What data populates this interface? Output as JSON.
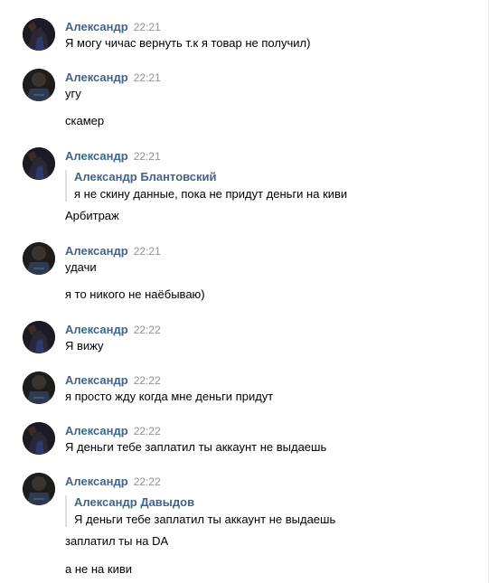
{
  "messages": [
    {
      "author": "Александр",
      "time": "22:21",
      "lines": [
        "Я могу чичас вернуть т.к я товар не получил)"
      ]
    },
    {
      "author": "Александр",
      "time": "22:21",
      "lines": [
        "угу",
        "скамер"
      ]
    },
    {
      "author": "Александр",
      "time": "22:21",
      "quote": {
        "author": "Александр Блантовский",
        "text": "я не скину данные, пока не придут деньги на киви"
      },
      "lines": [
        "Арбитраж"
      ]
    },
    {
      "author": "Александр",
      "time": "22:21",
      "lines": [
        "удачи",
        "я то никого не наёбываю)"
      ]
    },
    {
      "author": "Александр",
      "time": "22:22",
      "lines": [
        "Я вижу"
      ]
    },
    {
      "author": "Александр",
      "time": "22:22",
      "lines": [
        "я просто жду когда мне деньги придут"
      ]
    },
    {
      "author": "Александр",
      "time": "22:22",
      "lines": [
        "Я деньги тебе заплатил ты аккаунт не выдаешь"
      ]
    },
    {
      "author": "Александр",
      "time": "22:22",
      "quote": {
        "author": "Александр Давыдов",
        "text": "Я деньги тебе заплатил ты аккаунт не выдаешь"
      },
      "lines": [
        "заплатил ты на DA",
        "а не на киви"
      ]
    }
  ]
}
